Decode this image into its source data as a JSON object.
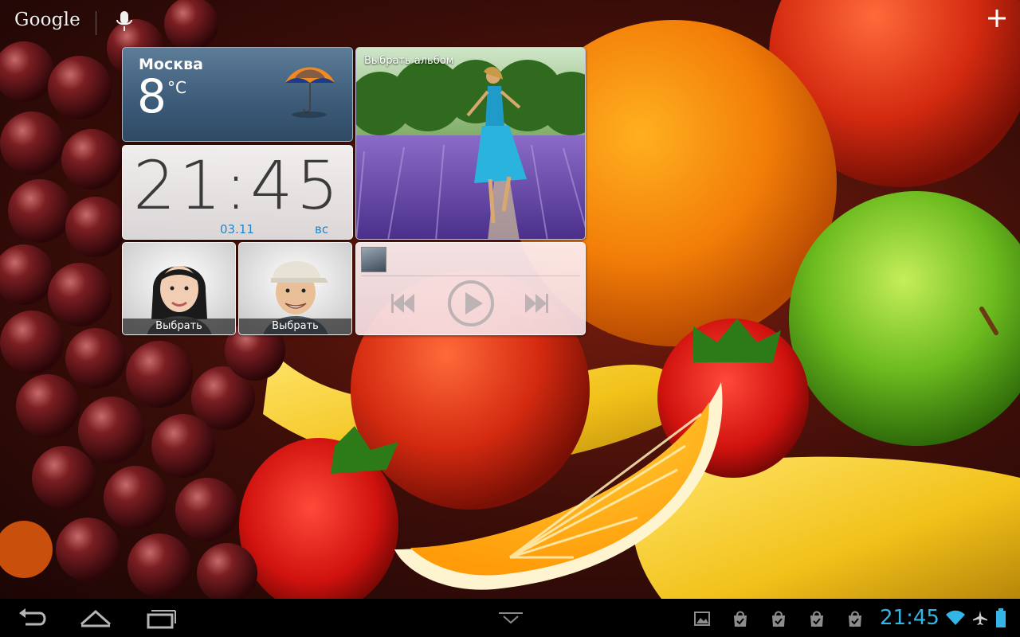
{
  "search": {
    "logo_text": "Google"
  },
  "weather": {
    "city": "Москва",
    "temp": "8",
    "unit": "°C"
  },
  "clock": {
    "time": "21:45",
    "date": "03.11",
    "day": "вс"
  },
  "photo_widget": {
    "title": "Выбрать альбом"
  },
  "contacts": [
    {
      "label": "Выбрать"
    },
    {
      "label": "Выбрать"
    }
  ],
  "status_bar": {
    "time": "21:45"
  },
  "colors": {
    "accent": "#33b5e5",
    "clock_blue": "#1f86c9"
  },
  "icons": [
    "mic-icon",
    "add-icon",
    "umbrella-icon",
    "prev-icon",
    "play-icon",
    "next-icon",
    "back-icon",
    "home-icon",
    "recents-icon",
    "menu-icon",
    "gallery-icon",
    "shopping-bag-icon",
    "wifi-icon",
    "airplane-icon",
    "battery-icon"
  ]
}
